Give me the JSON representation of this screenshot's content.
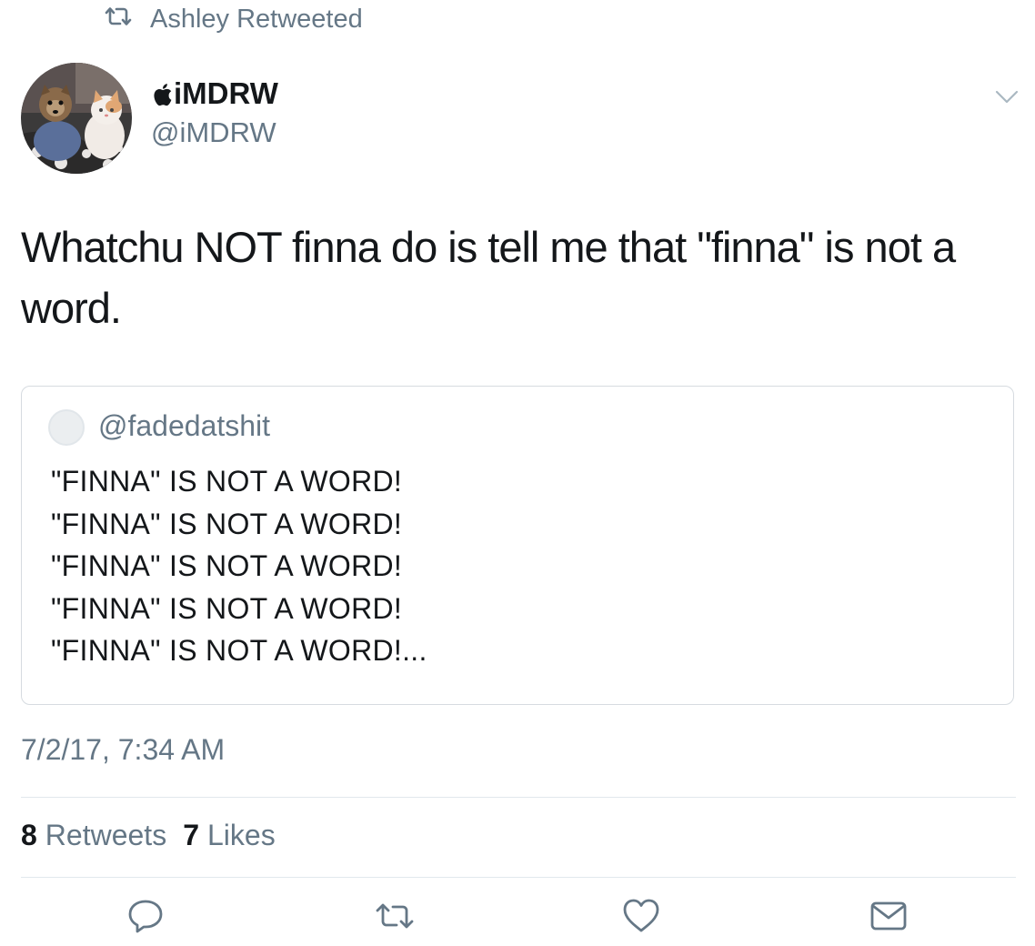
{
  "retweet_context": {
    "icon": "retweet-icon",
    "text": "Ashley Retweeted"
  },
  "author": {
    "avatar": "avatar-dog-and-cat",
    "display_name_badge": "apple-logo-icon",
    "display_name": "iMDRW",
    "handle": "@iMDRW"
  },
  "menu": {
    "icon": "chevron-down-icon"
  },
  "tweet": {
    "text": "Whatchu NOT finna do is tell me that \"finna\" is not a word."
  },
  "quoted_tweet": {
    "avatar": "default-avatar",
    "handle": "@fadedatshit",
    "lines": [
      "\"FINNA\" IS NOT A WORD!",
      "\"FINNA\" IS NOT A WORD!",
      "\"FINNA\" IS NOT A WORD!",
      "\"FINNA\" IS NOT A WORD!",
      "\"FINNA\" IS NOT A WORD!..."
    ]
  },
  "timestamp": "7/2/17, 7:34 AM",
  "stats": {
    "retweets_count": "8",
    "retweets_label": "Retweets",
    "likes_count": "7",
    "likes_label": "Likes"
  },
  "actions": [
    {
      "name": "reply",
      "icon": "reply-icon"
    },
    {
      "name": "retweet",
      "icon": "retweet-icon"
    },
    {
      "name": "like",
      "icon": "heart-icon"
    },
    {
      "name": "direct-message",
      "icon": "envelope-icon"
    }
  ],
  "colors": {
    "primary_text": "#14171a",
    "secondary_text": "#657786",
    "border": "#d6dbe0",
    "divider": "#e1e8ed",
    "icon": "#657786"
  }
}
